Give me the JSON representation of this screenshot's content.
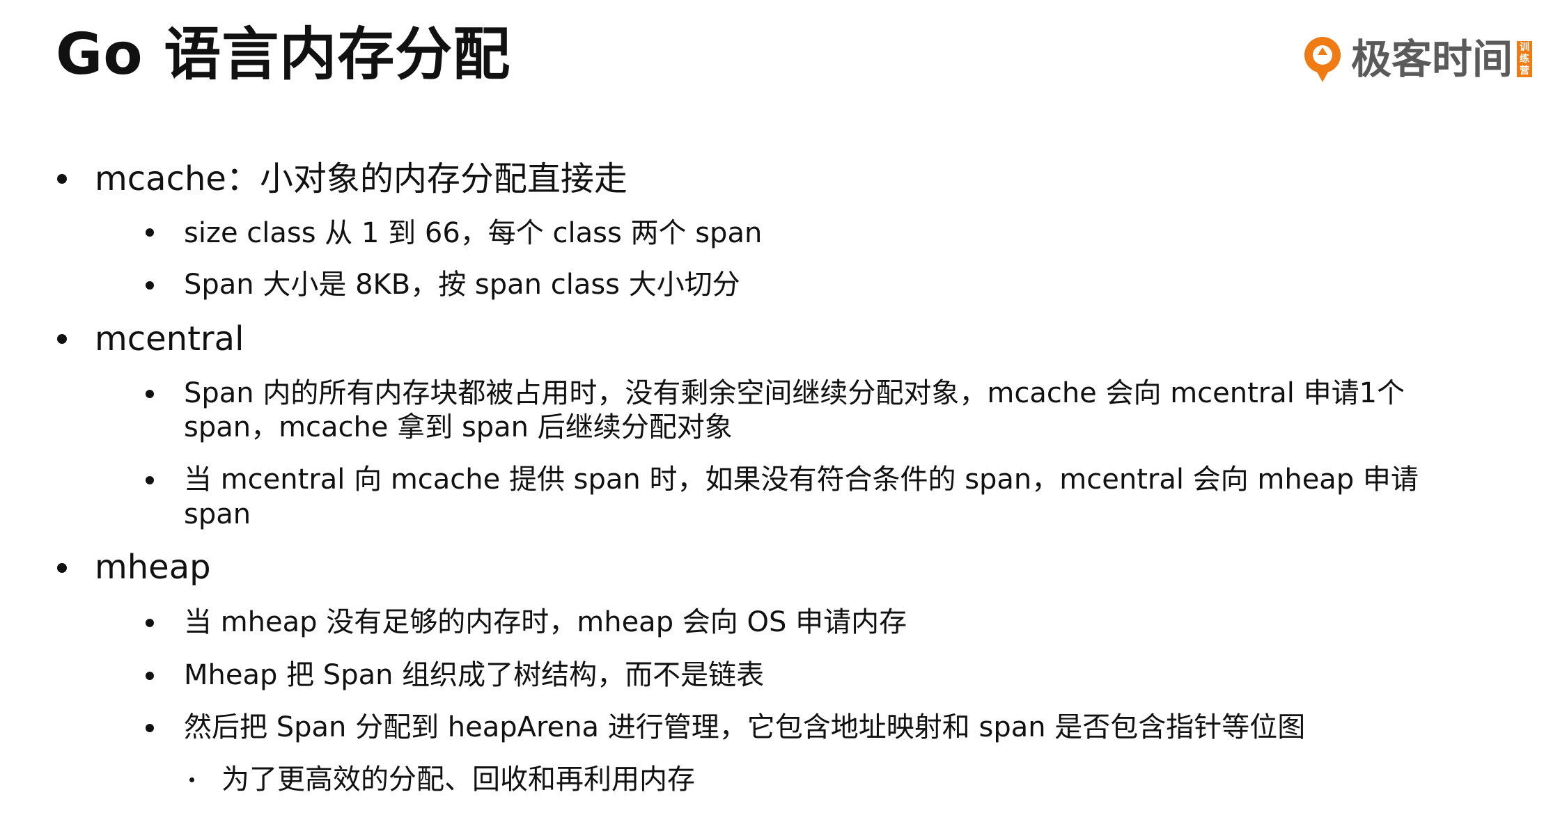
{
  "title": "Go 语言内存分配",
  "logo": {
    "text": "极客时间",
    "badge": "训练营",
    "accent_color": "#f07b14"
  },
  "bullets": {
    "mcache": "mcache：小对象的内存分配直接走",
    "mcache_1": "size class 从 1 到 66，每个 class 两个 span",
    "mcache_2": "Span 大小是 8KB，按 span class 大小切分",
    "mcentral": "mcentral",
    "mcentral_1a": "Span 内的所有内存块都被占用时，没有剩余空间继续分配对象，mcache 会向 mcentral 申请1个",
    "mcentral_1b": "span，mcache 拿到 span 后继续分配对象",
    "mcentral_2a": "当 mcentral 向 mcache 提供 span 时，如果没有符合条件的 span，mcentral 会向 mheap 申请",
    "mcentral_2b": "span",
    "mheap": "mheap",
    "mheap_1": "当 mheap 没有足够的内存时，mheap 会向 OS 申请内存",
    "mheap_2": "Mheap 把 Span 组织成了树结构，而不是链表",
    "mheap_3": "然后把 Span 分配到 heapArena 进行管理，它包含地址映射和 span 是否包含指针等位图",
    "mheap_3_1": "为了更高效的分配、回收和再利用内存"
  }
}
